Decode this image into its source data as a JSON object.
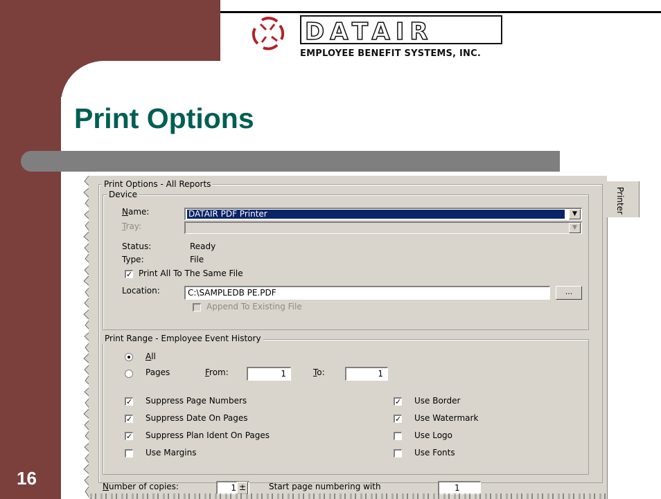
{
  "slide": {
    "logo_text": "EMPLOYEE BENEFIT SYSTEMS, INC.",
    "logo_name": "DATAIR",
    "title": "Print Options",
    "number": "16"
  },
  "dialog": {
    "group_label": "Print Options - All Reports",
    "tab_label": "Printer",
    "device": {
      "label": "Device",
      "name_label": "Name:",
      "name_value": "DATAIR PDF Printer",
      "tray_label": "Tray:",
      "status_label": "Status:",
      "status_value": "Ready",
      "type_label": "Type:",
      "type_value": "File",
      "print_all_label": "Print All To The Same File",
      "location_label": "Location:",
      "location_value": "C:\\SAMPLEDB   PE.PDF",
      "browse_label": "...",
      "append_label": "Append To Existing File"
    },
    "range": {
      "label": "Print Range - Employee Event History",
      "all_label": "All",
      "pages_label": "Pages",
      "from_label": "From:",
      "from_value": "1",
      "to_label": "To:",
      "to_value": "1"
    },
    "options_left": [
      {
        "label": "Suppress Page Numbers",
        "checked": true
      },
      {
        "label": "Suppress Date On Pages",
        "checked": true
      },
      {
        "label": "Suppress Plan Ident On Pages",
        "checked": true
      },
      {
        "label": "Use Margins",
        "checked": false
      }
    ],
    "options_right": [
      {
        "label": "Use Border",
        "checked": true
      },
      {
        "label": "Use Watermark",
        "checked": true
      },
      {
        "label": "Use Logo",
        "checked": false
      },
      {
        "label": "Use Fonts",
        "checked": false
      }
    ],
    "copies_label": "Number of copies:",
    "copies_value": "1",
    "start_page_label": "Start page numbering with",
    "start_page_value": "1"
  },
  "colors": {
    "maroon": "#7b3f3c",
    "title_green": "#005e53",
    "pill_gray": "#7f7f7f",
    "dialog_bg": "#d9d5cc",
    "selection_blue": "#0a246a"
  }
}
